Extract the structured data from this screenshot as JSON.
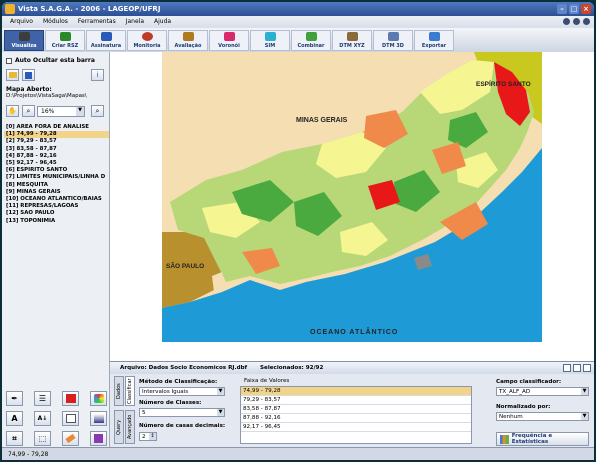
{
  "window": {
    "title": "Vista S.A.G.A. - 2006 - LAGEOP/UFRJ"
  },
  "menu": [
    "Arquivo",
    "Módulos",
    "Ferramentas",
    "Janela",
    "Ajuda"
  ],
  "toolbar": {
    "buttons": [
      {
        "label": "Visualiza",
        "icon": "eye-icon",
        "color": "#3d3d3d"
      },
      {
        "label": "Criar RSZ",
        "icon": "pencil-icon",
        "color": "#2a8a2a"
      },
      {
        "label": "Assinatura",
        "icon": "signature-icon",
        "color": "#2a5ab8"
      },
      {
        "label": "Monitoria",
        "icon": "clock-icon",
        "color": "#c03a2a"
      },
      {
        "label": "Avaliação",
        "icon": "check-icon",
        "color": "#b07a20"
      },
      {
        "label": "Voronói",
        "icon": "voronoi-icon",
        "color": "#d82a6a"
      },
      {
        "label": "SIM",
        "icon": "sim-icon",
        "color": "#2ab0d0"
      },
      {
        "label": "Combinar",
        "icon": "combine-icon",
        "color": "#40a040"
      },
      {
        "label": "DTM XYZ",
        "icon": "dtm-xyz-icon",
        "color": "#8a6a3a"
      },
      {
        "label": "DTM 3D",
        "icon": "dtm-3d-icon",
        "color": "#5a7ab0"
      },
      {
        "label": "Exportar",
        "icon": "export-icon",
        "color": "#3a7ad0"
      }
    ]
  },
  "sidebar": {
    "auto_hide_label": "Auto Ocultar esta barra",
    "map_open_label": "Mapa Aberto:",
    "map_path": "D:\\Projetos\\VistaSaga\\Mapas\\",
    "zoom": "16%",
    "layers": [
      "[0] ÁREA FORA DE ANÁLISE",
      "[1] 74,99 - 79,28",
      "[2] 79,29 - 83,57",
      "[3] 83,58 - 87,87",
      "[4] 87,88 - 92,16",
      "[5] 92,17 - 96,45",
      "[6] ESPÍRITO SANTO",
      "[7] LIMITES MUNICIPAIS/LINHA D",
      "[8] MESQUITA",
      "[9] MINAS GERAIS",
      "[10] OCEANO ATLÂNTICO/BAÍAS",
      "[11] REPRESAS/LAGOAS",
      "[12] SÃO PAULO",
      "[13] TOPONÍMIA"
    ],
    "selected_layer_index": 1
  },
  "map": {
    "labels": {
      "minas": "MINAS GERAIS",
      "espirito": "ESPÍRITO SANTO",
      "saopaulo": "SÃO PAULO",
      "oceano": "OCEANO   ATLÂNTICO"
    },
    "colors": {
      "minas": "#f5deb2",
      "espirito": "#c8c81e",
      "saopaulo": "#b8902e",
      "ocean": "#1e9bd7",
      "class1": "#f5f592",
      "class2": "#b8d878",
      "class3": "#4aaa40",
      "class4": "#f08a4a",
      "class5": "#e81818",
      "outside": "#8a8a8a"
    }
  },
  "attributes": {
    "file_label": "Arquivo: Dados Socio Economicos RJ.dbf",
    "selected_label": "Selecionados: 92/92",
    "tabs": [
      "Dados",
      "Classificar",
      "Query",
      "Avançado"
    ],
    "method_label": "Método de Classificação:",
    "method_value": "Intervalos Iguais",
    "classes_label": "Número de Classes:",
    "classes_value": "5",
    "decimals_label": "Número de casas decimais:",
    "decimals_value": "2",
    "ranges_header": "Faixa de Valores",
    "ranges": [
      "74,99 - 79,28",
      "79,29 - 83,57",
      "83,58 - 87,87",
      "87,88 - 92,16",
      "92,17 - 96,45"
    ],
    "field_label": "Campo classificador:",
    "field_value": "TX_ALF_AD",
    "normalized_label": "Normalizado por:",
    "normalized_value": "Nenhum",
    "stats_button": "Frequência e Estatísticas"
  },
  "status": {
    "text": "74,99 - 79,28"
  }
}
